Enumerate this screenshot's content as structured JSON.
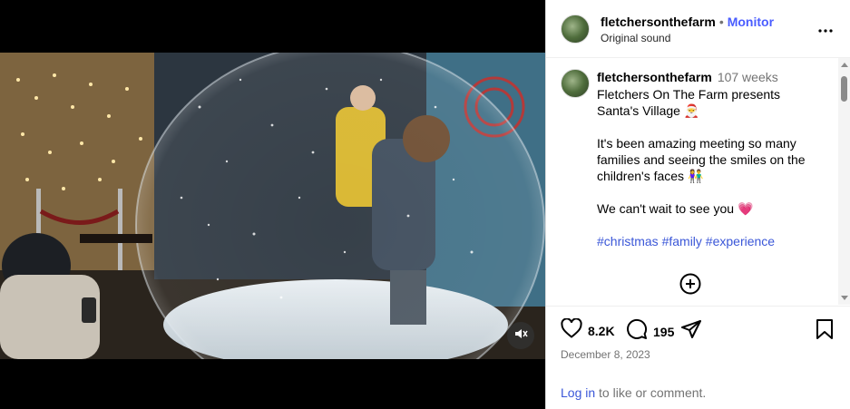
{
  "header": {
    "username": "fletchersonthefarm",
    "separator": "•",
    "follow_label": "Monitor",
    "audio": "Original sound"
  },
  "caption": {
    "username": "fletchersonthefarm",
    "time": "107 weeks",
    "line1": "Fletchers On The Farm presents Santa's Village",
    "emoji1": "🎅",
    "line2": "It's been amazing meeting so many families and seeing the smiles on the children's faces",
    "emoji2": "👫",
    "line3": "We can't wait to see you",
    "emoji3": "💗",
    "hashtags": "#christmas #family #experience"
  },
  "actions": {
    "likes": "8.2K",
    "comments": "195"
  },
  "post": {
    "date": "December 8, 2023"
  },
  "login": {
    "link": "Log in",
    "suffix": " to like or comment."
  },
  "icons": {
    "like": "heart-icon",
    "comment": "comment-bubble-icon",
    "share": "paper-plane-icon",
    "save": "bookmark-icon",
    "more": "more-options-icon",
    "mute": "sound-off-icon",
    "add_comment": "plus-circle-icon"
  }
}
